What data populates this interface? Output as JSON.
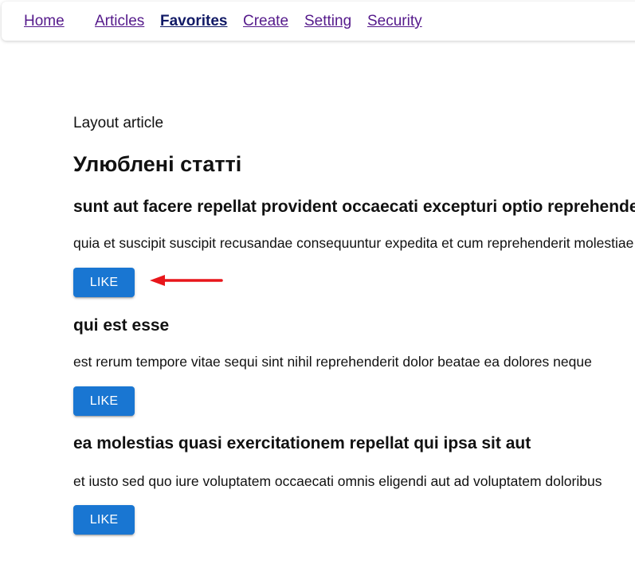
{
  "nav": {
    "items": [
      {
        "id": "home",
        "label": "Home",
        "active": false
      },
      {
        "id": "articles",
        "label": "Articles",
        "active": false
      },
      {
        "id": "favorites",
        "label": "Favorites",
        "active": true
      },
      {
        "id": "create",
        "label": "Create",
        "active": false
      },
      {
        "id": "setting",
        "label": "Setting",
        "active": false
      },
      {
        "id": "security",
        "label": "Security",
        "active": false
      }
    ]
  },
  "main": {
    "layout_label": "Layout article",
    "title": "Улюблені статті",
    "articles": [
      {
        "title": "sunt aut facere repellat provident occaecati excepturi optio reprehenderit",
        "body": "quia et suscipit suscipit recusandae consequuntur expedita et cum reprehenderit molestiae",
        "like_label": "LIKE"
      },
      {
        "title": "qui est esse",
        "body": "est rerum tempore vitae sequi sint nihil reprehenderit dolor beatae ea dolores neque",
        "like_label": "LIKE"
      },
      {
        "title": "ea molestias quasi exercitationem repellat qui ipsa sit aut",
        "body": "et iusto sed quo iure voluptatem occaecati omnis eligendi aut ad voluptatem doloribus",
        "like_label": "LIKE"
      }
    ]
  },
  "annotation": {
    "arrow_color": "#e8161b",
    "points_to": "first-like-button"
  },
  "colors": {
    "button": "#1976d2",
    "link": "#551a8b",
    "active_link": "#111a66"
  }
}
